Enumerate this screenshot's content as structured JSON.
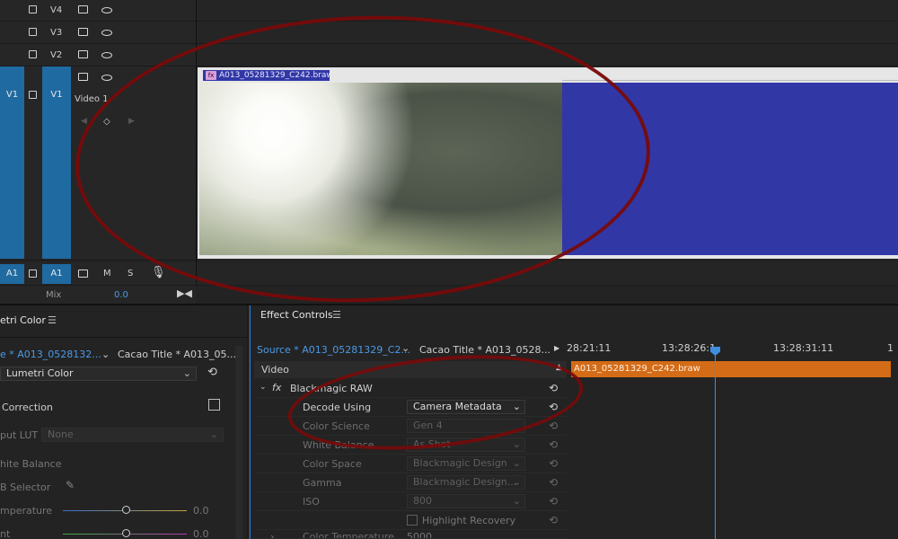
{
  "timeline": {
    "tracks": [
      {
        "label": "V4"
      },
      {
        "label": "V3"
      },
      {
        "label": "V2"
      },
      {
        "src": "V1",
        "label": "V1",
        "name": "Video 1"
      }
    ],
    "audio": {
      "src": "A1",
      "label": "A1",
      "m": "M",
      "s": "S"
    },
    "mix": {
      "label": "Mix",
      "value": "0.0"
    },
    "clip": {
      "name": "A013_05281329_C242.braw",
      "fx": "fx"
    }
  },
  "lumetri": {
    "title": "etri Color",
    "source_tab": "e * A013_0528132...",
    "seq_tab": "Cacao Title * A013_05...",
    "effect": "Lumetri Color",
    "section": "Correction",
    "input_lut_label": "put LUT",
    "input_lut_value": "None",
    "white_balance": "hite Balance",
    "wb_selector": "B Selector",
    "temperature": "mperature",
    "temperature_value": "0.0",
    "tint": "nt",
    "tint_value": "0.0"
  },
  "effect_controls": {
    "title": "Effect Controls",
    "source_tab": "Source * A013_05281329_C2...",
    "seq_tab": "Cacao Title * A013_0528...",
    "section": "Video",
    "effect": "Blackmagic RAW",
    "rows": [
      {
        "label": "Decode Using",
        "value": "Camera Metadata"
      },
      {
        "label": "Color Science",
        "value": "Gen 4"
      },
      {
        "label": "White Balance",
        "value": "As Shot"
      },
      {
        "label": "Color Space",
        "value": "Blackmagic Design"
      },
      {
        "label": "Gamma",
        "value": "Blackmagic Design..."
      },
      {
        "label": "ISO",
        "value": "800"
      }
    ],
    "highlight_recovery": "Highlight Recovery",
    "color_temp_label": "Color Temperature",
    "color_temp_value": "5000",
    "timecodes": [
      "28:21:11",
      "13:28:26:1",
      "13:28:31:11",
      "1"
    ],
    "clip_name": "A013_05281329_C242.braw"
  }
}
